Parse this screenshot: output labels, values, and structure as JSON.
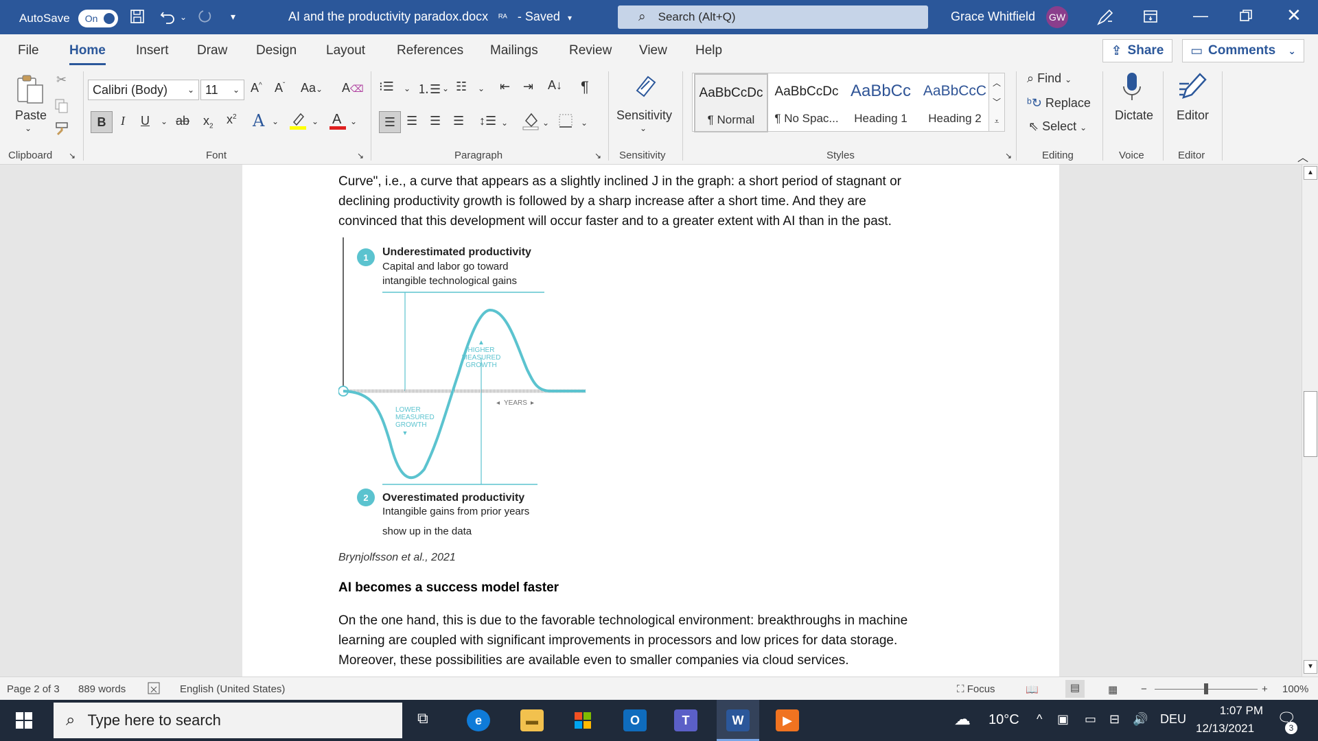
{
  "titlebar": {
    "autosave_label": "AutoSave",
    "autosave_state": "On",
    "doc_title": "AI and the productivity paradox.docx",
    "save_state": "- Saved",
    "search_placeholder": "Search (Alt+Q)",
    "user_name": "Grace Whitfield",
    "user_initials": "GW"
  },
  "tabs": [
    "File",
    "Home",
    "Insert",
    "Draw",
    "Design",
    "Layout",
    "References",
    "Mailings",
    "Review",
    "View",
    "Help"
  ],
  "active_tab": "Home",
  "share_label": "Share",
  "comments_label": "Comments",
  "ribbon": {
    "paste_label": "Paste",
    "font_name": "Calibri (Body)",
    "font_size": "11",
    "change_case": "Aa",
    "sensitivity_label": "Sensitivity",
    "styles": [
      {
        "sample": "AaBbCcDc",
        "name": "¶ Normal"
      },
      {
        "sample": "AaBbCcDc",
        "name": "¶ No Spac..."
      },
      {
        "sample": "AaBbCc",
        "name": "Heading 1"
      },
      {
        "sample": "AaBbCcC",
        "name": "Heading 2"
      }
    ],
    "find_label": "Find",
    "replace_label": "Replace",
    "select_label": "Select",
    "dictate_label": "Dictate",
    "editor_label": "Editor",
    "groups": [
      "Clipboard",
      "Font",
      "Paragraph",
      "Sensitivity",
      "Styles",
      "Editing",
      "Voice",
      "Editor"
    ]
  },
  "document": {
    "paragraph1_lines": [
      "Curve\", i.e., a curve that appears as a slightly inclined J in the graph: a short period of stagnant or",
      "declining productivity growth is followed by a sharp increase after a short time. And they are",
      "convinced that this development will occur faster and to a greater extent with AI than in the past."
    ],
    "figure": {
      "callout1_num": "1",
      "callout1_title": "Underestimated productivity",
      "callout1_line1": "Capital and labor go toward",
      "callout1_line2": "intangible technological gains",
      "higher_line1": "HIGHER",
      "higher_line2": "MEASURED",
      "higher_line3": "GROWTH",
      "lower_line1": "LOWER",
      "lower_line2": "MEASURED",
      "lower_line3": "GROWTH",
      "years_label": "YEARS",
      "callout2_num": "2",
      "callout2_title": "Overestimated productivity",
      "callout2_line1": "Intangible gains from prior years",
      "callout2_line2": "show up in the data",
      "curve_color": "#5bc3cf"
    },
    "caption": "Brynjolfsson et al., 2021",
    "heading": "AI becomes a success model faster",
    "paragraph2_lines": [
      "On the one hand, this is due to the favorable technological environment: breakthroughs in machine",
      "learning are coupled with significant improvements in processors and low prices for data storage.",
      "Moreover, these possibilities are available even to smaller companies via cloud services."
    ]
  },
  "statusbar": {
    "page": "Page 2 of 3",
    "words": "889 words",
    "language": "English (United States)",
    "focus": "Focus",
    "zoom": "100%"
  },
  "taskbar": {
    "search_placeholder": "Type here to search",
    "weather": "10°C",
    "language": "DEU",
    "time": "1:07 PM",
    "date": "12/13/2021",
    "notifications": "3"
  },
  "colors": {
    "titlebar": "#2b579a",
    "accent": "#2b579a",
    "taskbar": "#1f2a3a"
  }
}
